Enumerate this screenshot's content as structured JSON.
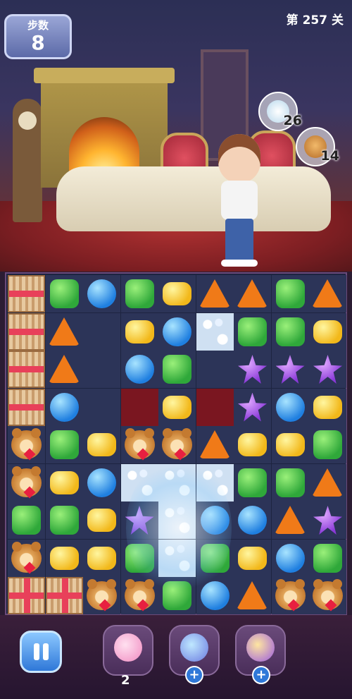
{
  "hud": {
    "moves_label": "步数",
    "moves_value": "8",
    "level_text": "第 257 关"
  },
  "goals": [
    {
      "icon": "bubble-foam-icon",
      "count": "26"
    },
    {
      "icon": "teddy-bear-icon",
      "count": "14"
    }
  ],
  "board": {
    "rows": 9,
    "cols": 9,
    "cells": [
      [
        "crate",
        "g",
        "b",
        "g",
        "y",
        "o",
        "o",
        "g",
        "o"
      ],
      [
        "crate",
        "o",
        "bg",
        "y",
        "b",
        "foam",
        "g",
        "g",
        "y"
      ],
      [
        "crate",
        "o",
        "bg",
        "b",
        "g",
        "bg",
        "p",
        "p",
        "p"
      ],
      [
        "crate",
        "b",
        "bg",
        "dred",
        "y",
        "dred",
        "p",
        "b",
        "y"
      ],
      [
        "bear",
        "g",
        "y",
        "bear",
        "bear",
        "o",
        "y",
        "y",
        "g"
      ],
      [
        "bear",
        "y",
        "b",
        "foam",
        "foam",
        "foam",
        "g",
        "g",
        "o"
      ],
      [
        "g",
        "g",
        "y",
        "p",
        "foam",
        "b",
        "b",
        "o",
        "p"
      ],
      [
        "bear",
        "y",
        "y",
        "g",
        "foam",
        "g",
        "y",
        "b",
        "g"
      ],
      [
        "gift",
        "gift",
        "bear",
        "bear",
        "g",
        "b",
        "o",
        "bear",
        "bear"
      ]
    ]
  },
  "boosters": [
    {
      "icon": "lollipop-hammer-icon",
      "count": "2"
    },
    {
      "icon": "rocket-hammer-icon",
      "add": "+"
    },
    {
      "icon": "magic-hammer-icon",
      "add": "+"
    }
  ],
  "colors": {
    "board_bg": "#1d2440",
    "accent_blue": "#2f78d8"
  }
}
